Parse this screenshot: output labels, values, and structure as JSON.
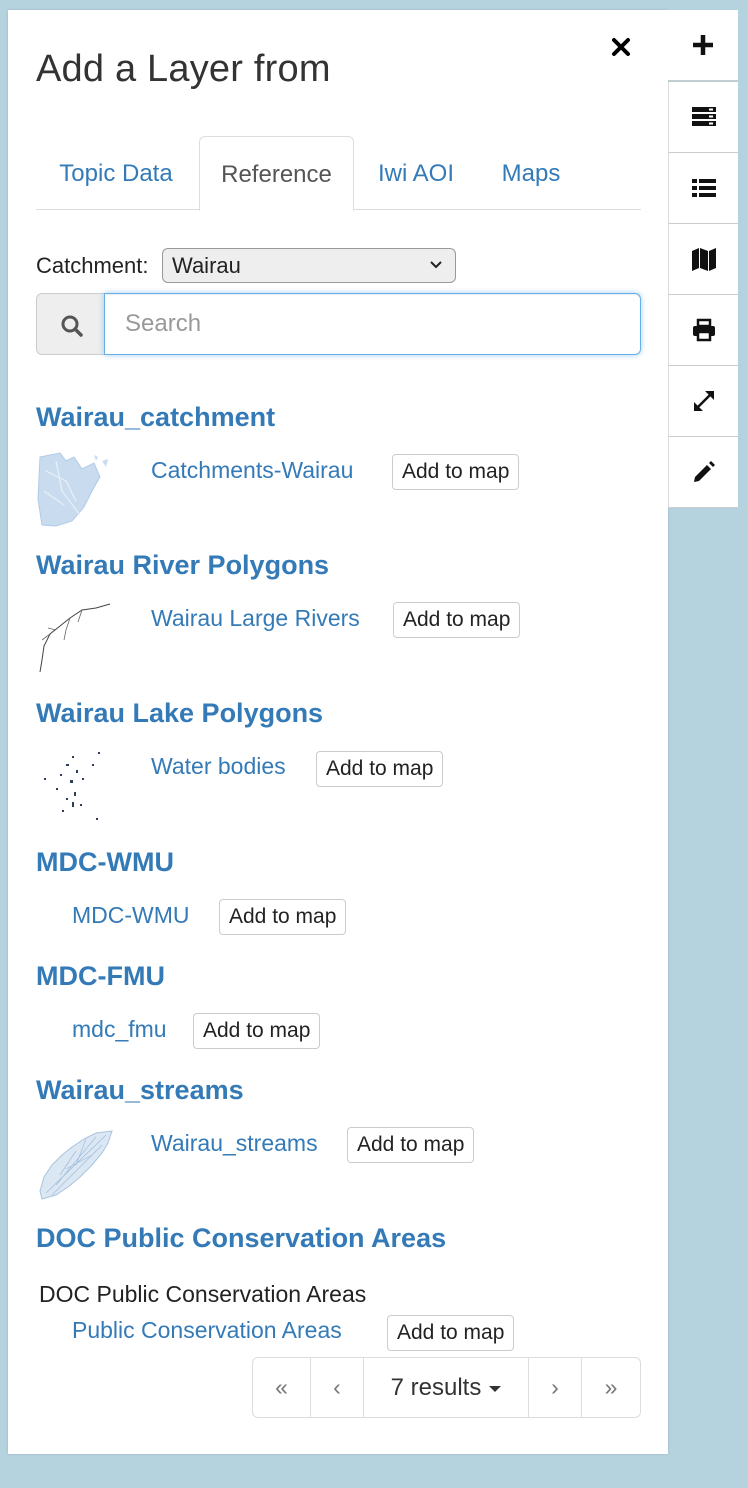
{
  "panel": {
    "title": "Add a Layer from",
    "close_icon": "close-icon"
  },
  "tabs": [
    {
      "label": "Topic Data",
      "active": false
    },
    {
      "label": "Reference",
      "active": true
    },
    {
      "label": "Iwi AOI",
      "active": false
    },
    {
      "label": "Maps",
      "active": false
    }
  ],
  "catchment": {
    "label": "Catchment:",
    "value": "Wairau"
  },
  "search": {
    "placeholder": "Search",
    "value": ""
  },
  "groups": [
    {
      "title": "Wairau_catchment",
      "layer": "Catchments-Wairau",
      "add": "Add to map",
      "thumb": "catchment-thumbnail"
    },
    {
      "title": "Wairau River Polygons",
      "layer": "Wairau Large Rivers",
      "add": "Add to map",
      "thumb": "rivers-thumbnail"
    },
    {
      "title": "Wairau Lake Polygons",
      "layer": "Water bodies",
      "add": "Add to map",
      "thumb": "lakes-thumbnail"
    },
    {
      "title": "MDC-WMU",
      "layer": "MDC-WMU",
      "add": "Add to map"
    },
    {
      "title": "MDC-FMU",
      "layer": "mdc_fmu",
      "add": "Add to map"
    },
    {
      "title": "Wairau_streams",
      "layer": "Wairau_streams",
      "add": "Add to map",
      "thumb": "streams-thumbnail"
    },
    {
      "title": "DOC Public Conservation Areas",
      "sublabel": "DOC Public Conservation Areas",
      "layer": "Public Conservation Areas",
      "add": "Add to map"
    }
  ],
  "pagination": {
    "first": "«",
    "prev": "‹",
    "results": "7 results",
    "next": "›",
    "last": "»"
  },
  "toolbar": [
    {
      "name": "add-layer",
      "icon": "plus-icon"
    },
    {
      "name": "layers",
      "icon": "server-icon"
    },
    {
      "name": "legend",
      "icon": "list-icon"
    },
    {
      "name": "basemap",
      "icon": "map-icon"
    },
    {
      "name": "print",
      "icon": "print-icon"
    },
    {
      "name": "fullscreen",
      "icon": "expand-icon"
    },
    {
      "name": "draw",
      "icon": "pencil-icon"
    }
  ],
  "colors": {
    "background": "#b4d3df",
    "link": "#337ab7",
    "focus": "#66afe9"
  }
}
